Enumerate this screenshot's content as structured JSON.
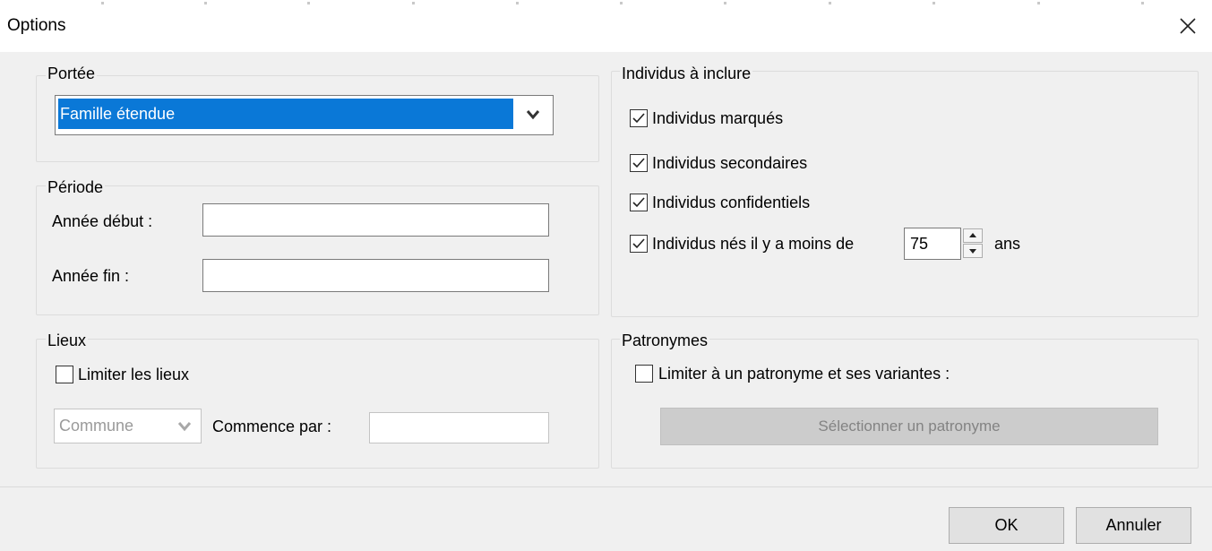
{
  "window": {
    "title": "Options",
    "close_icon": "close-icon"
  },
  "scope": {
    "legend": "Portée",
    "selected": "Famille étendue"
  },
  "period": {
    "legend": "Période",
    "start_label": "Année début :",
    "start_value": "",
    "end_label": "Année fin :",
    "end_value": ""
  },
  "places": {
    "legend": "Lieux",
    "limit_label": "Limiter les lieux",
    "limit_checked": false,
    "type_selected": "Commune",
    "starts_with_label": "Commence par :",
    "starts_with_value": ""
  },
  "individuals": {
    "legend": "Individus à inclure",
    "options": [
      {
        "label": "Individus marqués",
        "checked": true
      },
      {
        "label": "Individus secondaires",
        "checked": true
      },
      {
        "label": "Individus confidentiels",
        "checked": true
      },
      {
        "label": "Individus nés il y a moins de",
        "checked": true
      }
    ],
    "years_value": "75",
    "years_unit": "ans"
  },
  "surnames": {
    "legend": "Patronymes",
    "limit_label": "Limiter à un patronyme et ses variantes :",
    "limit_checked": false,
    "select_button": "Sélectionner un patronyme"
  },
  "footer": {
    "ok": "OK",
    "cancel": "Annuler"
  },
  "colors": {
    "selection": "#0a78d7",
    "background": "#f0f0f0",
    "titlebar": "#ffffff"
  }
}
